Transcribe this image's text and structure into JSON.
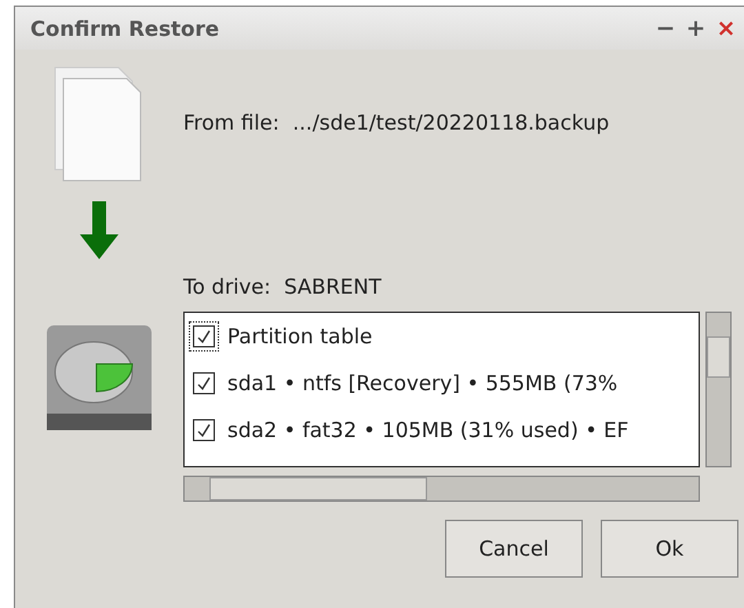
{
  "window": {
    "title": "Confirm Restore",
    "controls": [
      "−",
      "+",
      "×"
    ]
  },
  "source": {
    "label": "From file:",
    "value": ".../sde1/test/20220118.backup"
  },
  "target": {
    "label": "To drive:",
    "value": "SABRENT"
  },
  "partitions": [
    {
      "label": "Partition table",
      "checked": true,
      "focused": true
    },
    {
      "label": "sda1 • ntfs [Recovery] • 555MB (73%",
      "checked": true,
      "focused": false
    },
    {
      "label": "sda2 • fat32 • 105MB (31% used) • EF",
      "checked": true,
      "focused": false
    }
  ],
  "buttons": [
    "Cancel",
    "Ok"
  ]
}
